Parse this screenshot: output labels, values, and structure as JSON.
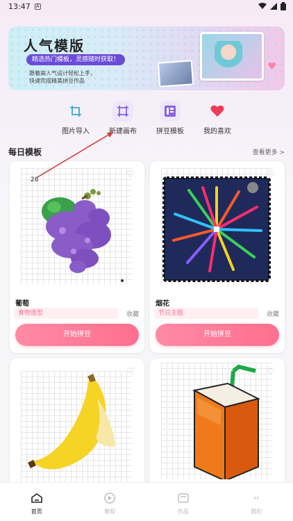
{
  "status_bar": {
    "time": "13:47"
  },
  "banner": {
    "title": "人气模版",
    "chip": "精选热门模板，灵感随时获取！",
    "subtitle_line1": "跟着高人气设计轻松上手，",
    "subtitle_line2": "快速完成精美拼豆作品"
  },
  "shortcuts": [
    {
      "label": "图片导入",
      "icon": "crop-icon"
    },
    {
      "label": "新建画布",
      "icon": "canvas-icon"
    },
    {
      "label": "拼豆模板",
      "icon": "template-icon"
    },
    {
      "label": "我的喜欢",
      "icon": "heart-icon"
    }
  ],
  "section": {
    "title": "每日模板",
    "more": "查看更多 >"
  },
  "cards": [
    {
      "name": "葡萄",
      "tag": "食物造型",
      "collect": "收藏",
      "button": "开始拼豆",
      "count": "28"
    },
    {
      "name": "烟花",
      "tag": "节日主题",
      "collect": "收藏",
      "button": "开始拼豆"
    }
  ],
  "tabbar": [
    {
      "label": "首页",
      "active": true
    },
    {
      "label": "教程",
      "active": false
    },
    {
      "label": "作品",
      "active": false
    },
    {
      "label": "我的",
      "active": false
    }
  ],
  "colors": {
    "accent": "#ff6f8f",
    "tag_bg": "#ffeef2",
    "banner_chip": "#6c4bd8"
  }
}
